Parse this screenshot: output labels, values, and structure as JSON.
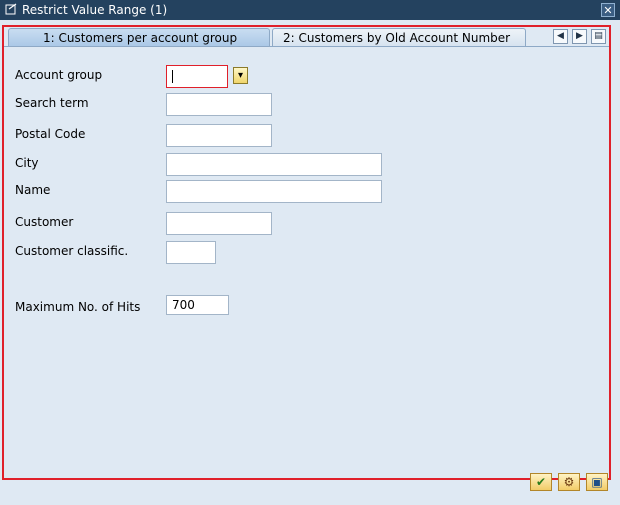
{
  "window": {
    "title": "Restrict Value Range (1)",
    "close_glyph": "✕"
  },
  "tabs": [
    {
      "label": "1: Customers per account group",
      "active": true
    },
    {
      "label": "2: Customers by Old Account Number",
      "active": false
    }
  ],
  "tab_nav": {
    "prev": "◀",
    "next": "▶",
    "list": "▤"
  },
  "form": {
    "account_group": {
      "label": "Account group",
      "value": ""
    },
    "search_term": {
      "label": "Search term",
      "value": ""
    },
    "postal_code": {
      "label": "Postal Code",
      "value": ""
    },
    "city": {
      "label": "City",
      "value": ""
    },
    "name": {
      "label": "Name",
      "value": ""
    },
    "customer": {
      "label": "Customer",
      "value": ""
    },
    "customer_classific": {
      "label": "Customer classific.",
      "value": ""
    },
    "max_hits": {
      "label": "Maximum No. of Hits",
      "value": "700"
    }
  },
  "buttons": {
    "continue": "✔",
    "find": "⚙",
    "restrict": "▣"
  },
  "colors": {
    "frame_highlight": "#e0202a",
    "titlebar": "#24425f",
    "background": "#dfe9f3"
  }
}
